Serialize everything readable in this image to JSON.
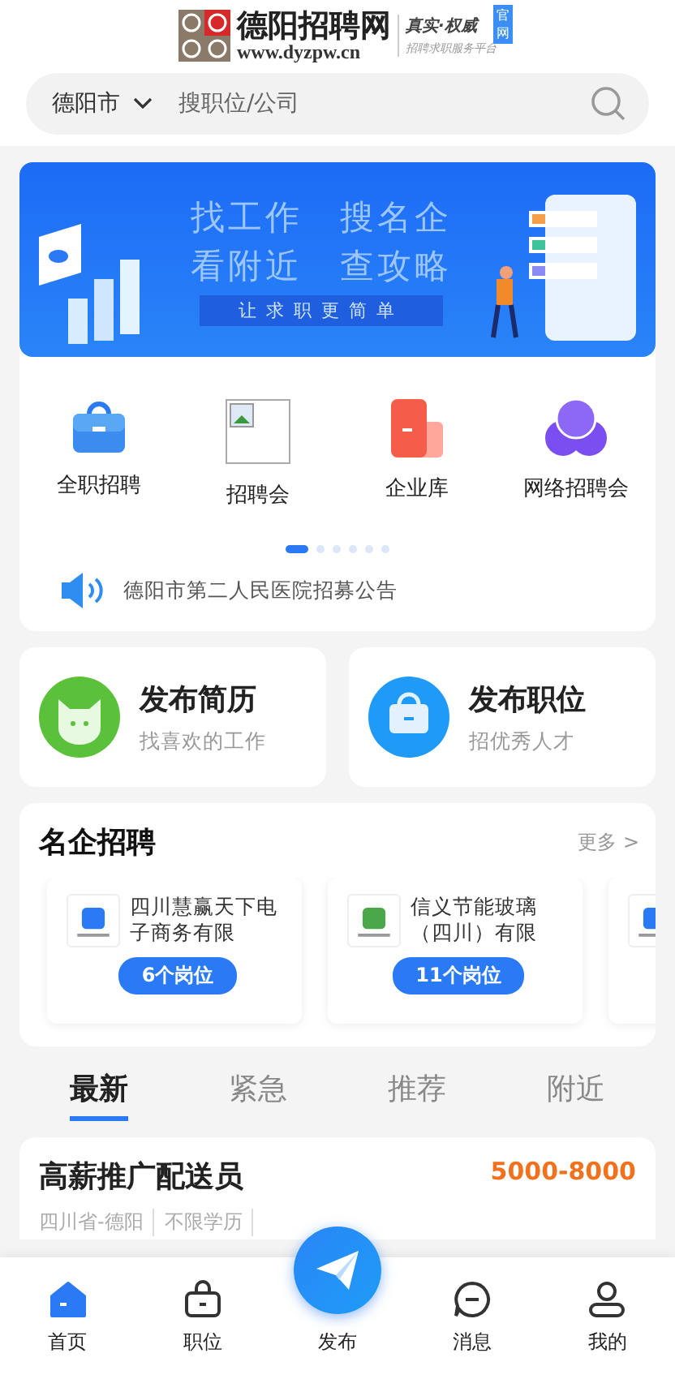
{
  "header": {
    "logo_title": "德阳招聘网",
    "logo_url": "www.dyzpw.cn",
    "slogan": "真实·权威",
    "badge": "官网",
    "subtitle": "招聘求职服务平台"
  },
  "search": {
    "city": "德阳市",
    "placeholder": "搜职位/公司"
  },
  "banner": {
    "lines": [
      "找工作　搜名企",
      "看附近　查攻略"
    ],
    "tagline": "让求职更简单"
  },
  "shortcuts": [
    {
      "kind": "briefcase",
      "label": "全职招聘"
    },
    {
      "kind": "broken",
      "label": "招聘会"
    },
    {
      "kind": "building",
      "label": "企业库"
    },
    {
      "kind": "circles",
      "label": "网络招聘会"
    }
  ],
  "pager": [
    {
      "selected": true
    },
    {
      "selected": false
    },
    {
      "selected": false
    },
    {
      "selected": false
    },
    {
      "selected": false
    },
    {
      "selected": false
    }
  ],
  "notice": "德阳市第二人民医院招募公告",
  "post_cards": [
    {
      "kind": "resume",
      "title": "发布简历",
      "subtitle": "找喜欢的工作"
    },
    {
      "kind": "job",
      "title": "发布职位",
      "subtitle": "招优秀人才"
    }
  ],
  "companies": {
    "title": "名企招聘",
    "more": "更多 >",
    "items": [
      {
        "kind": "full",
        "name": "四川慧赢天下电子商务有限",
        "jobs": "6个岗位"
      },
      {
        "kind": "full",
        "name": "信义节能玻璃（四川）有限",
        "jobs": "11个岗位"
      },
      {
        "kind": "logo_only"
      }
    ]
  },
  "tabs": [
    {
      "label": "最新",
      "selected": true
    },
    {
      "label": "紧急",
      "selected": false
    },
    {
      "label": "推荐",
      "selected": false
    },
    {
      "label": "附近",
      "selected": false
    }
  ],
  "job": {
    "title": "高薪推广配送员",
    "salary": "5000-8000",
    "tags": [
      "四川省-德阳",
      "不限学历"
    ]
  },
  "nav": [
    {
      "kind": "home",
      "label": "首页",
      "selected": true
    },
    {
      "kind": "bag",
      "label": "职位",
      "selected": false
    },
    {
      "kind": "publish",
      "label": "发布",
      "selected": false
    },
    {
      "kind": "chat",
      "label": "消息",
      "selected": false
    },
    {
      "kind": "user",
      "label": "我的",
      "selected": false
    }
  ]
}
